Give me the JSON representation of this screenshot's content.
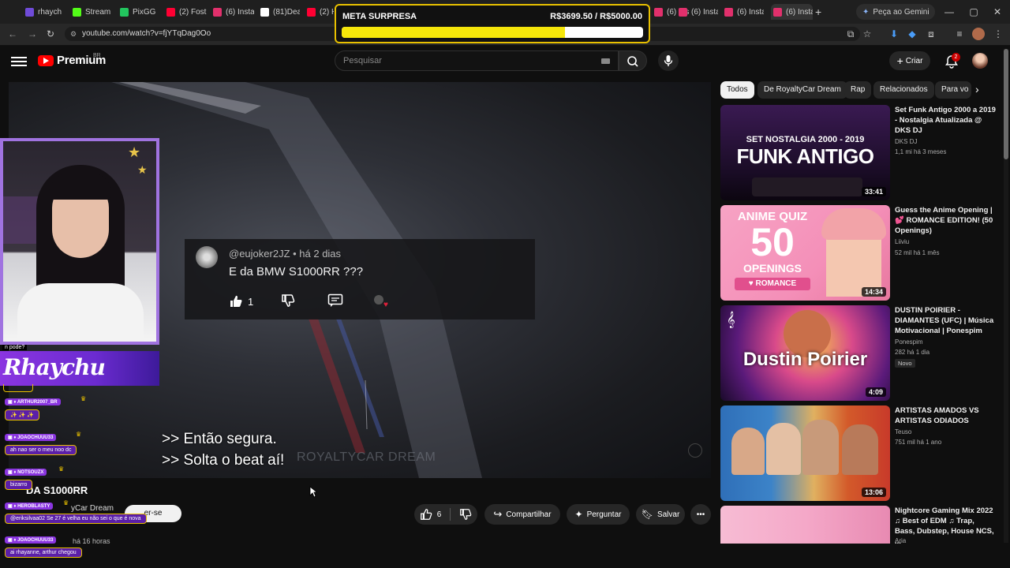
{
  "browser": {
    "tabs": [
      {
        "label": "rhaych",
        "color": "#6f4bd8"
      },
      {
        "label": "Stream",
        "color": "#53fc18"
      },
      {
        "label": "PixGG",
        "color": "#22c55e"
      },
      {
        "label": "(2) Fost",
        "color": "#ff0033"
      },
      {
        "label": "(6) Insta",
        "color": "#e1306c"
      },
      {
        "label": "(81)Dea",
        "color": "#ffffff"
      },
      {
        "label": "(2) Hi",
        "color": "#ff0033"
      }
    ],
    "tabs_right": [
      {
        "label": "(6) Insta",
        "color": "#e1306c"
      },
      {
        "label": "(6) Insta",
        "color": "#e1306c"
      },
      {
        "label": "(6) Insta",
        "color": "#e1306c"
      },
      {
        "label": "(6) Insta",
        "color": "#e1306c"
      }
    ],
    "new_tab": "+",
    "gemini": "Peça ao Gemini",
    "url": "youtube.com/watch?v=fjYTqDag0Oo"
  },
  "meta": {
    "title": "META SURPRESA",
    "value": "R$3699.50 / R$5000.00",
    "progress": 0.74
  },
  "youtube": {
    "logo": "Premium",
    "region": "BR",
    "search_placeholder": "Pesquisar",
    "create": "Criar",
    "notifications": "2",
    "video": {
      "comment_author": "@eujoker2JZ • há 2 dias",
      "comment_text": "E da BMW S1000RR ???",
      "comment_likes": "1",
      "subtitle_1": ">> Então segura.",
      "subtitle_2": ">> Solta o beat aí!",
      "watermark": "ROYALTYCAR DREAM"
    },
    "title": "DA S1000RR",
    "channel": "yCar Dream",
    "subscribe": "er-se",
    "posted": "há 16 horas",
    "actions": {
      "likes": "6",
      "share": "Compartilhar",
      "ask": "Perguntar",
      "save": "Salvar"
    },
    "chips": [
      "Todos",
      "De RoyaltyCar Dream",
      "Rap",
      "Relacionados",
      "Para vo"
    ],
    "recommended": [
      {
        "title": "Set Funk Antigo 2000 a 2019 - Nostalgia Atualizada @ DKS DJ",
        "channel": "DKS DJ",
        "meta": "1,1 mi  há 3 meses",
        "duration": "33:41",
        "thumb_top": "SET NOSTALGIA 2000 - 2019",
        "thumb_main": "FUNK ANTIGO",
        "thumb_bg": "#2a1438"
      },
      {
        "title": "Guess the Anime Opening | 💕 ROMANCE EDITION! (50 Openings)",
        "channel": "Liiviu",
        "meta": "52 mil  há 1 mês",
        "duration": "14:34",
        "thumb_top": "ANIME QUIZ",
        "thumb_main": "50",
        "thumb_sub": "OPENINGS",
        "thumb_tag": "♥ ROMANCE",
        "thumb_bg": "#f48fb8"
      },
      {
        "title": "DUSTIN POIRIER - DIAMANTES (UFC) | Música Motivacional | Ponespim",
        "channel": "Ponespim",
        "meta": "282  há 1 dia",
        "badge": "Novo",
        "duration": "4:09",
        "thumb_main": "Dustin Poirier",
        "thumb_bg": "#6b1a6e"
      },
      {
        "title": "ARTISTAS AMADOS VS ARTISTAS ODIADOS",
        "channel": "Teuso",
        "meta": "751 mil  há 1 ano",
        "duration": "13:06",
        "thumb_bg": "#2f6fb8"
      },
      {
        "title": "Nightcore Gaming Mix 2022 ♫ Best of EDM ♫ Trap, Bass, Dubstep, House NCS, ...",
        "channel": "Aria",
        "thumb_bg": "#f4a8c8"
      }
    ]
  },
  "stream": {
    "question": "n pode?",
    "brand": "Rhaychu",
    "chat": [
      {
        "user": "",
        "msg": ""
      },
      {
        "user": "ARTHUR2007_BR",
        "msg": "✨ ✨ ✨"
      },
      {
        "user": "JOAOCHUUU33",
        "msg": "ah nao ser o meu noo dc"
      },
      {
        "user": "NOTSOUZX",
        "msg": "bizarro"
      },
      {
        "user": "HEROBLASTY",
        "msg": "@eriksilvaa02 Se 27 é velha eu não sei o que é nova"
      },
      {
        "user": "JOAOCHUUU33",
        "msg": "ai rhayanne, arthur chegou"
      }
    ]
  }
}
